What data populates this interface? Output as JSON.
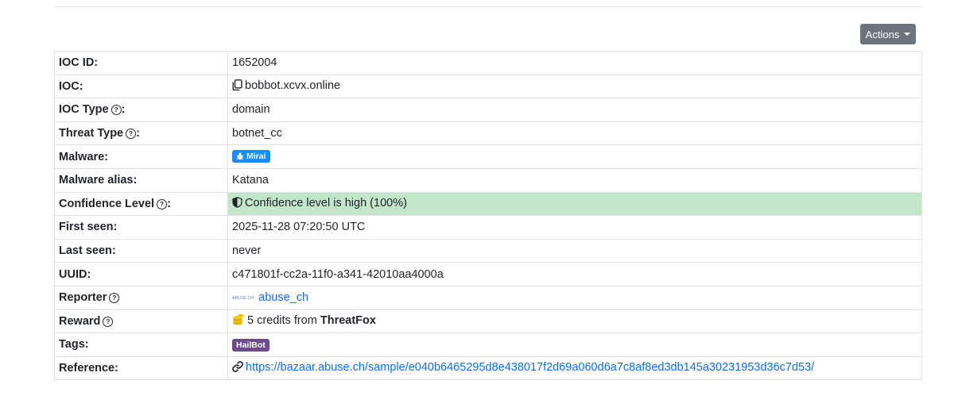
{
  "actions_label": "Actions",
  "rows": {
    "ioc_id": {
      "label": "IOC ID:",
      "value": "1652004"
    },
    "ioc": {
      "label": "IOC:",
      "value": "bobbot.xcvx.online"
    },
    "ioc_type": {
      "label": "IOC Type",
      "suffix": ":",
      "value": "domain"
    },
    "threat_type": {
      "label": "Threat Type",
      "suffix": ":",
      "value": "botnet_cc"
    },
    "malware": {
      "label": "Malware:",
      "value": "Mirai"
    },
    "malware_alias": {
      "label": "Malware alias:",
      "value": "Katana"
    },
    "confidence": {
      "label": "Confidence Level",
      "suffix": ":",
      "value": "Confidence level is high (100%)"
    },
    "first_seen": {
      "label": "First seen:",
      "value": "2025-11-28 07:20:50 UTC"
    },
    "last_seen": {
      "label": "Last seen:",
      "value": "never"
    },
    "uuid": {
      "label": "UUID:",
      "value": "c471801f-cc2a-11f0-a341-42010aa4000a"
    },
    "reporter": {
      "label": "Reporter",
      "logo_text": "ABUSE.CH",
      "value": "abuse_ch"
    },
    "reward": {
      "label": "Reward",
      "value_prefix": "5 credits from ",
      "value_bold": "ThreatFox"
    },
    "tags": {
      "label": "Tags:",
      "value": "HailBot"
    },
    "reference": {
      "label": "Reference:",
      "value": "https://bazaar.abuse.ch/sample/e040b6465295d8e438017f2d69a060d6a7c8af8ed3db145a30231953d36c7d53/"
    }
  },
  "colors": {
    "confidence_bg": "#c3e6cb",
    "mirai_badge": "#1a8cff",
    "tag_badge": "#6c4b8a",
    "link": "#0d6efd",
    "actions_bg": "#6c757d"
  }
}
